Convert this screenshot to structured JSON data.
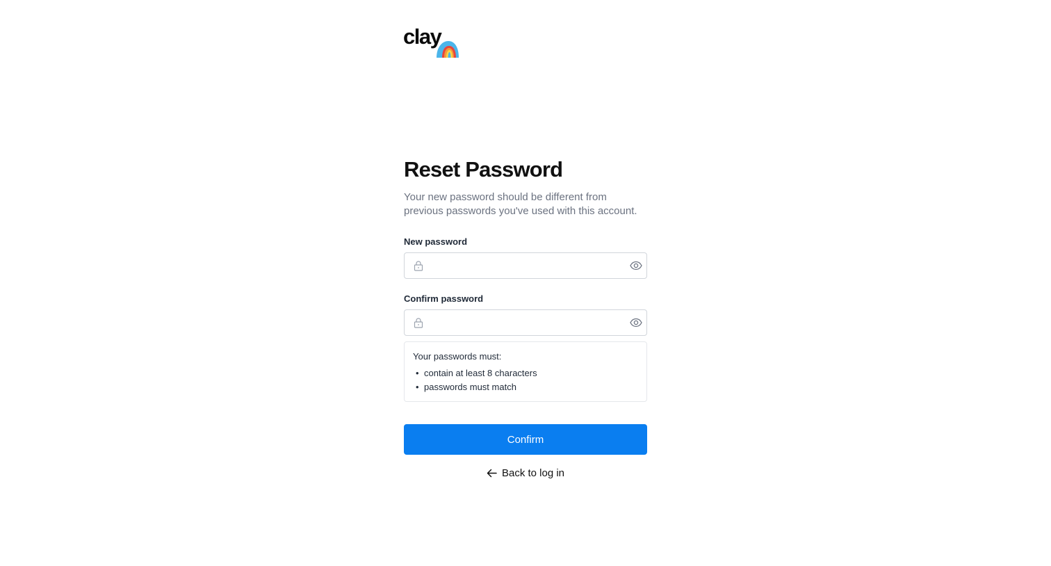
{
  "brand": {
    "name": "clay"
  },
  "heading": {
    "title": "Reset Password",
    "subtitle": "Your new password should be different from previous passwords you've used with this account."
  },
  "fields": {
    "new_password": {
      "label": "New password",
      "value": "",
      "placeholder": ""
    },
    "confirm_password": {
      "label": "Confirm password",
      "value": "",
      "placeholder": ""
    }
  },
  "requirements": {
    "title": "Your passwords must:",
    "items": [
      "contain at least 8 characters",
      "passwords must match"
    ]
  },
  "actions": {
    "confirm_label": "Confirm",
    "back_label": "Back to log in"
  },
  "icons": {
    "lock": "lock-icon",
    "eye": "eye-icon",
    "arrow_left": "arrow-left-icon"
  },
  "colors": {
    "primary": "#0a7ef0",
    "text_muted": "#6b7280",
    "border": "#d1d5db"
  }
}
